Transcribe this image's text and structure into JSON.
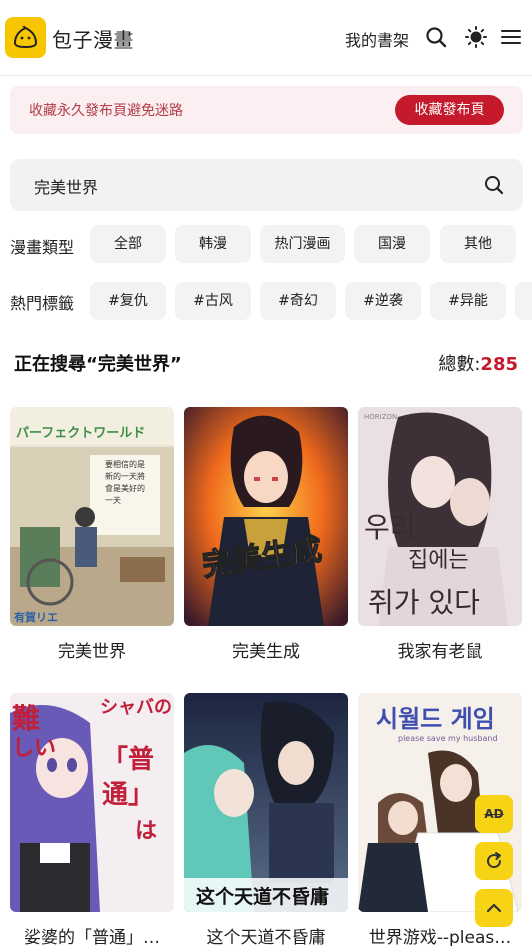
{
  "header": {
    "site_name": "包子漫畫",
    "bookshelf_label": "我的書架"
  },
  "notice": {
    "text": "收藏永久發布頁避免迷路",
    "button_label": "收藏發布頁"
  },
  "search": {
    "value": "完美世界"
  },
  "filters": {
    "type_label": "漫畫類型",
    "types": [
      "全部",
      "韩漫",
      "热门漫画",
      "国漫",
      "其他"
    ],
    "tag_label": "熱門標籤",
    "tags": [
      "#复仇",
      "#古风",
      "#奇幻",
      "#逆袭",
      "#异能"
    ]
  },
  "results": {
    "title": "正在搜尋“完美世界”",
    "count_label": "總數:",
    "count": "285"
  },
  "comics": [
    {
      "title": "完美世界"
    },
    {
      "title": "完美生成"
    },
    {
      "title": "我家有老鼠"
    },
    {
      "title": "娑婆的「普通」…"
    },
    {
      "title": "这个天道不昏庸"
    },
    {
      "title": "世界游戏--pleas…"
    }
  ],
  "covers": {
    "c1_text": "パーフェクトワールド",
    "c1_text2": "要相信的是新的一天將會是美好的一天",
    "c2_text": "完美生成",
    "c3_text": "우리 집에는 쥐가 있다",
    "c3_brand": "HORIZON",
    "c4_text": "シャバの「普通」は難しい",
    "c5_text": "这个天道不昏庸",
    "c6_text": "시월드 게임",
    "c6_sub": "please save my husband"
  },
  "fab": {
    "ad_label": "AD"
  },
  "colors": {
    "brand_yellow": "#f7c600",
    "accent_red": "#c41a2b",
    "notice_bg": "#fceff1"
  }
}
